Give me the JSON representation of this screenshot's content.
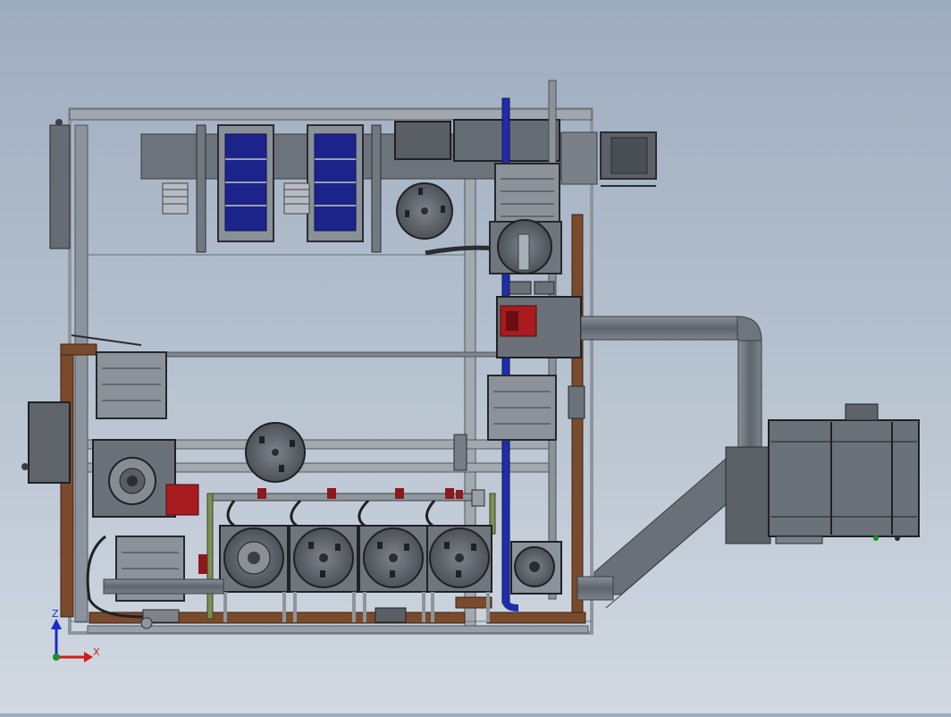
{
  "window": {
    "title": ""
  },
  "view": {
    "orientation": "top",
    "style": "shaded-with-edges"
  },
  "triad": {
    "vertical_axis": "Z",
    "horizontal_axis": "X",
    "colors": {
      "z": "#1b2bd0",
      "x": "#d01b1b",
      "origin": "#1a8f2a"
    }
  },
  "colors": {
    "frame": "#8c939c",
    "frame_dark": "#5c636c",
    "equipment": "#6d737b",
    "equipment_dark": "#44494f",
    "blue_panel": "#1c238a",
    "blue_pipe": "#1f2ea8",
    "copper": "#7a4a2c",
    "red_motor": "#a81c20",
    "duct": "#6e747c",
    "pipe_green": "#7d8f56"
  },
  "components": {
    "filter_units": 2,
    "round_tanks_row": 4,
    "rectangular_baskets": 4,
    "large_duct": 1,
    "external_cabinet": 1
  }
}
